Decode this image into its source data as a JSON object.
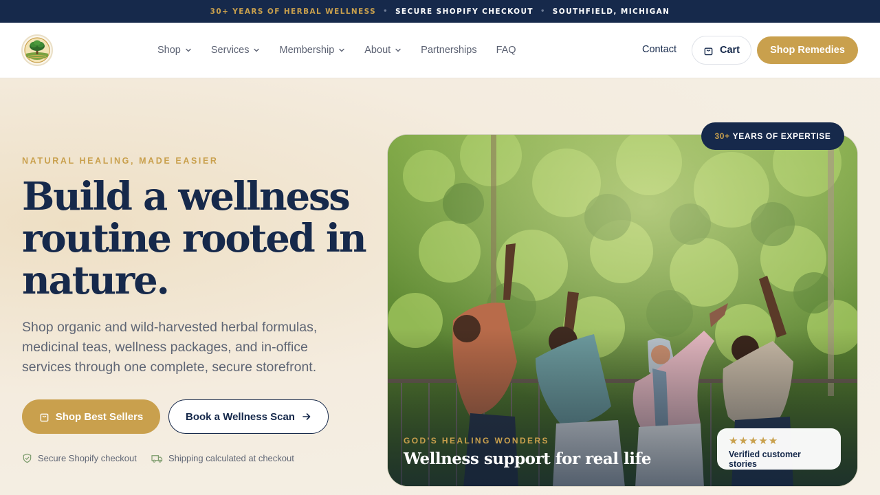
{
  "announcement": {
    "years": "30+ YEARS OF HERBAL WELLNESS",
    "checkout": "SECURE SHOPIFY CHECKOUT",
    "location": "SOUTHFIELD, MICHIGAN"
  },
  "nav": {
    "items": [
      {
        "label": "Shop"
      },
      {
        "label": "Services"
      },
      {
        "label": "Membership"
      },
      {
        "label": "About"
      },
      {
        "label": "Partnerships"
      },
      {
        "label": "FAQ"
      }
    ],
    "contact": "Contact",
    "cart": "Cart",
    "shop_remedies": "Shop Remedies"
  },
  "hero": {
    "eyebrow": "NATURAL HEALING, MADE EASIER",
    "headline": "Build a wellness routine rooted in nature.",
    "subtitle": "Shop organic and wild-harvested herbal formulas, medicinal teas, wellness packages, and in-office services through one complete, secure storefront.",
    "primary_cta": "Shop Best Sellers",
    "secondary_cta": "Book a Wellness Scan",
    "trust": [
      {
        "label": "Secure Shopify checkout",
        "icon": "shield-check-icon"
      },
      {
        "label": "Shipping calculated at checkout",
        "icon": "truck-icon"
      }
    ]
  },
  "photo": {
    "badge_years": "30+",
    "badge_text": "YEARS OF EXPERTISE",
    "caption_eyebrow": "GOD'S HEALING WONDERS",
    "caption_title": "Wellness support for real life",
    "review_text": "Verified customer stories",
    "rating": 5
  },
  "colors": {
    "navy": "#16294b",
    "gold": "#c9a04d",
    "cream": "#f5efe3"
  }
}
